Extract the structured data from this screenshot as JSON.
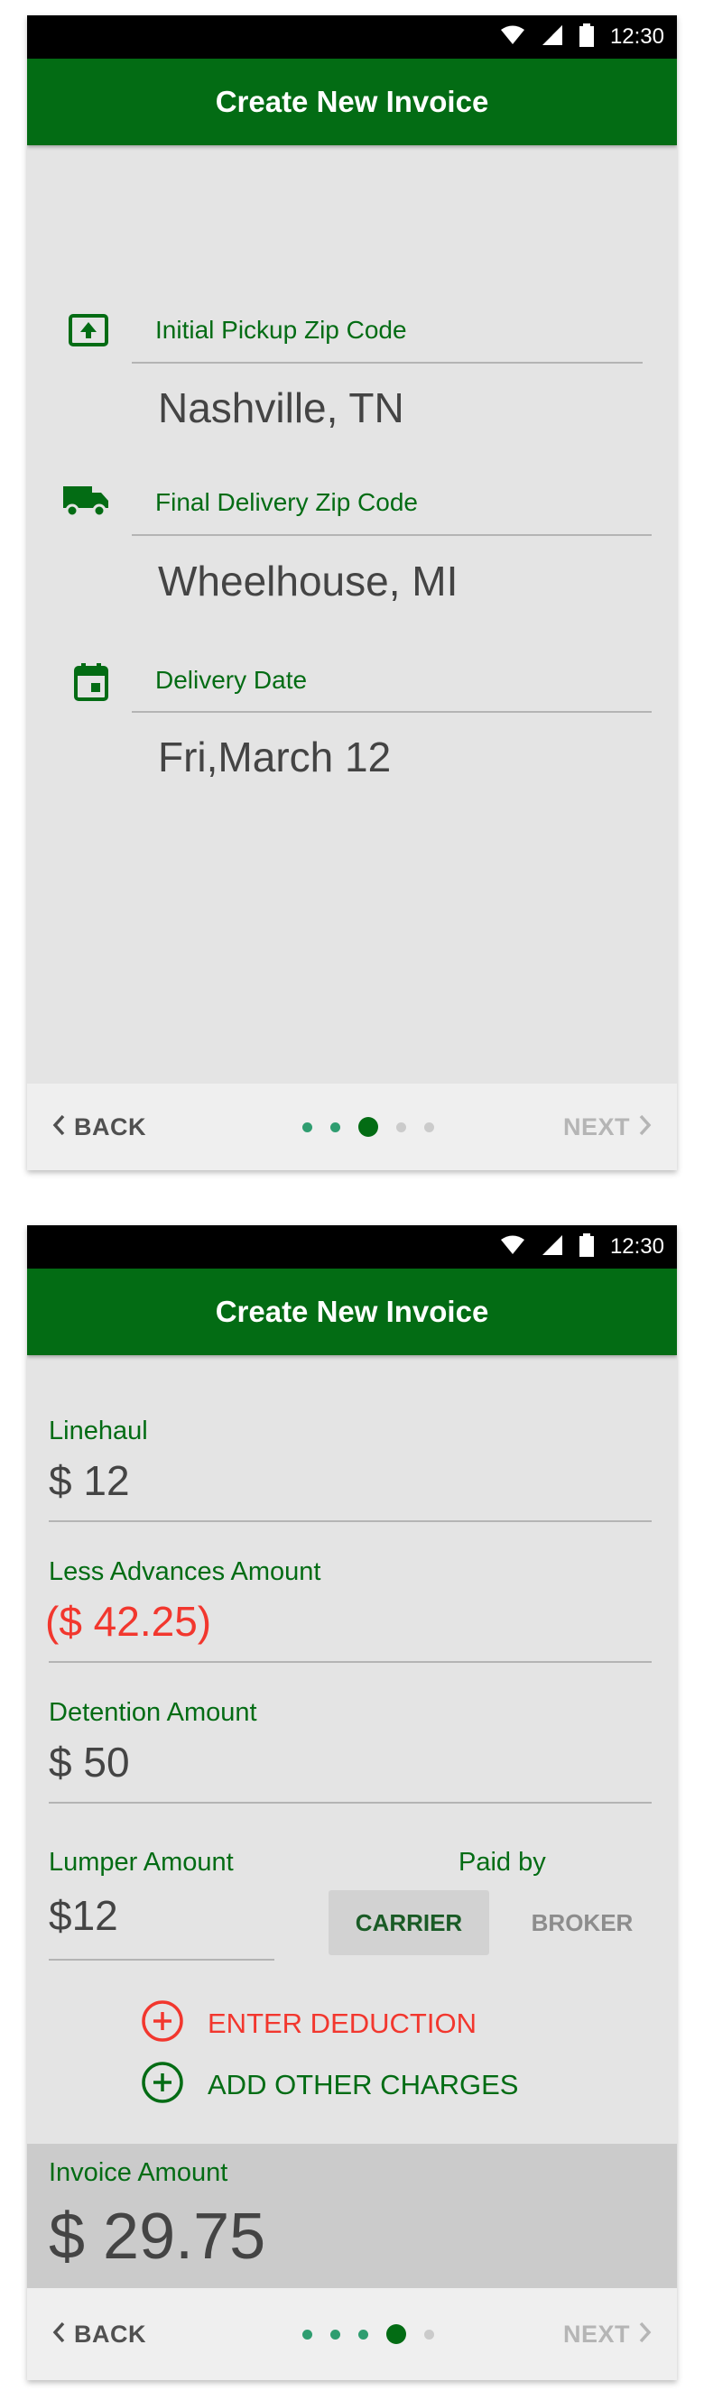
{
  "status_bar": {
    "time": "12:30",
    "icons": [
      "wifi-icon",
      "signal-icon",
      "battery-icon"
    ]
  },
  "colors": {
    "primary": "#036c14",
    "negative": "#f2372e",
    "background": "#e4e4e4"
  },
  "screen1": {
    "title": "Create New Invoice",
    "fields": [
      {
        "icon": "pickup-upload-icon",
        "label": "Initial Pickup Zip Code",
        "value": "Nashville, TN"
      },
      {
        "icon": "truck-icon",
        "label": "Final Delivery Zip Code",
        "value": "Wheelhouse, MI"
      },
      {
        "icon": "calendar-icon",
        "label": "Delivery Date",
        "value": "Fri,March 12"
      }
    ],
    "nav": {
      "back": "BACK",
      "next": "NEXT",
      "step": 3,
      "steps": 5
    }
  },
  "screen2": {
    "title": "Create New Invoice",
    "linehaul": {
      "label": "Linehaul",
      "value": "$ 12"
    },
    "advances": {
      "label": "Less Advances Amount",
      "value": "($ 42.25)"
    },
    "detention": {
      "label": "Detention Amount",
      "value": "$ 50"
    },
    "lumper": {
      "label": "Lumper Amount",
      "value": "$12",
      "paid_by_label": "Paid by",
      "options": [
        "CARRIER",
        "BROKER"
      ],
      "selected": "CARRIER"
    },
    "actions": {
      "deduction": "ENTER DEDUCTION",
      "other_charges": "ADD OTHER CHARGES"
    },
    "invoice": {
      "label": "Invoice Amount",
      "value": "$ 29.75"
    },
    "nav": {
      "back": "BACK",
      "next": "NEXT",
      "step": 4,
      "steps": 5
    }
  }
}
